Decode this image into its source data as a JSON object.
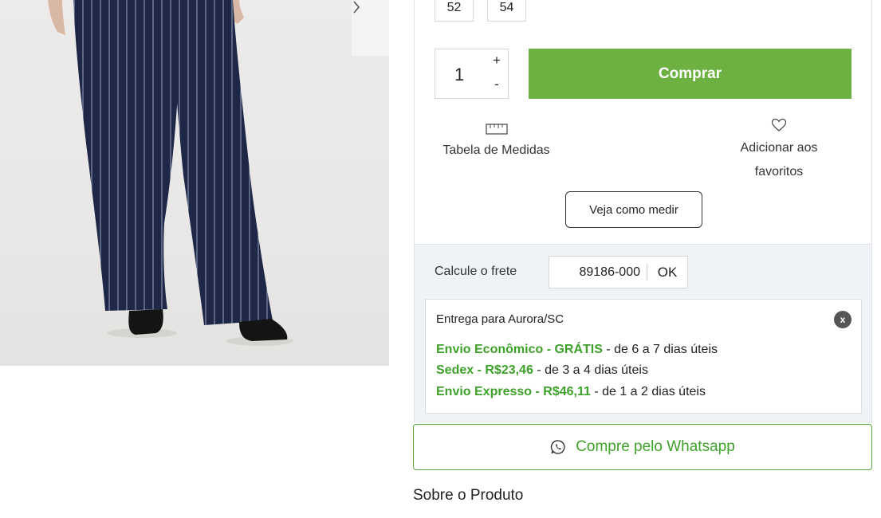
{
  "gallery": {
    "next_icon": "chevron-right-icon"
  },
  "sizes": [
    "52",
    "54"
  ],
  "quantity": {
    "value": "1",
    "plus_label": "+",
    "minus_label": "-"
  },
  "buy_label": "Comprar",
  "measure_table": {
    "icon": "ruler-icon",
    "label": "Tabela de Medidas"
  },
  "favorites": {
    "icon": "heart-icon",
    "label_line1": "Adicionar aos",
    "label_line2": "favoritos"
  },
  "how_to_measure_label": "Veja como medir",
  "shipping": {
    "label": "Calcule o frete",
    "cep_value": "89186-000",
    "ok_label": "OK",
    "result_title": "Entrega para Aurora/SC",
    "close_label": "x",
    "options": [
      {
        "name": "Envio Econômico -  GRÁTIS",
        "detail": " - de 6 a 7 dias úteis"
      },
      {
        "name": "Sedex - R$23,46",
        "detail": " - de 3 a 4 dias úteis"
      },
      {
        "name": "Envio Expresso - R$46,11",
        "detail": " - de 1 a 2 dias úteis"
      }
    ]
  },
  "whatsapp": {
    "icon": "whatsapp-icon",
    "label": "Compre pelo Whatsapp"
  },
  "about_title": "Sobre o Produto",
  "colors": {
    "buy_green": "#6cb142",
    "shipping_green": "#3ea22a",
    "shipping_bg": "#eff3f7"
  }
}
